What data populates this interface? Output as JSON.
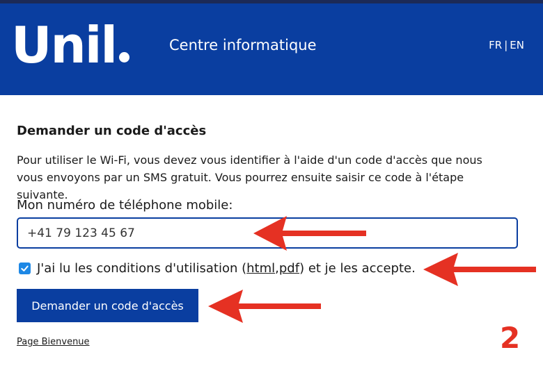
{
  "header": {
    "logo_text": "Unil",
    "site_title": "Centre informatique",
    "lang_fr": "FR",
    "lang_sep": "|",
    "lang_en": "EN"
  },
  "main": {
    "title": "Demander un code d'accès",
    "description": "Pour utiliser le Wi-Fi, vous devez vous identifier à l'aide d'un code d'accès que nous vous envoyons par un SMS gratuit. Vous pourrez ensuite saisir ce code à l'étape suivante.",
    "phone_label": "Mon numéro de téléphone mobile:",
    "phone_value": "+41 79 123 45 67",
    "terms_prefix": "J'ai lu les conditions d'utilisation (",
    "terms_html": "html",
    "terms_comma": ", ",
    "terms_pdf": "pdf",
    "terms_suffix": ") et je les accepte.",
    "terms_checked": true,
    "submit_label": "Demander un code d'accès",
    "welcome_link": "Page Bienvenue"
  },
  "annotation": {
    "step_number": "2",
    "arrow_color": "#e53123"
  },
  "colors": {
    "brand_blue": "#0a3ea0",
    "checkbox_blue": "#1e88e5"
  }
}
